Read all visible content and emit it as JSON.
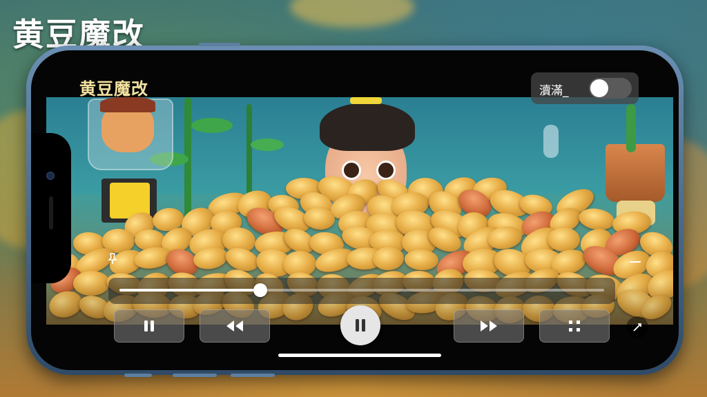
{
  "header": {
    "title": "黄豆魔改"
  },
  "player": {
    "video_title": "黄豆魔改",
    "toggle": {
      "label": "瀆滿_",
      "on": false
    },
    "progress": {
      "fraction": 0.29
    }
  },
  "controls": {
    "pause_label": "pause",
    "rewind_label": "rewind",
    "play_pause_label": "pause",
    "forward_label": "fast-forward",
    "fullscreen_label": "fullscreen"
  },
  "colors": {
    "title_text": "#f4e3a0",
    "accent": "#ffffff",
    "bean": "#e8b04a"
  }
}
